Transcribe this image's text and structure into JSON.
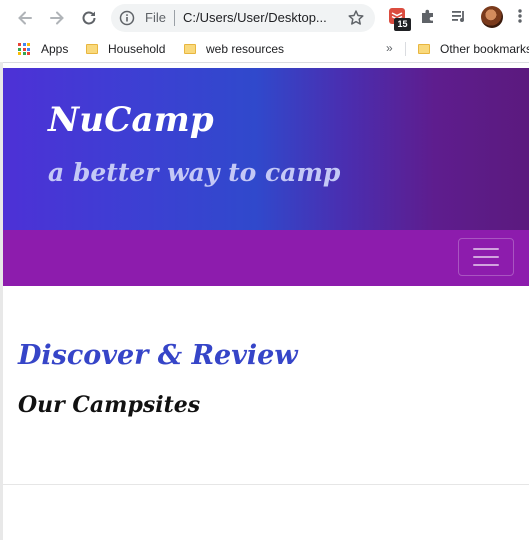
{
  "browser": {
    "address_scheme": "File",
    "address_url": "C:/Users/User/Desktop...",
    "extension_badge": "15",
    "bookmarks": [
      {
        "label": "Apps",
        "icon": "apps-grid-icon"
      },
      {
        "label": "Household",
        "icon": "folder-icon"
      },
      {
        "label": "web resources",
        "icon": "folder-icon"
      },
      {
        "label": "Other bookmarks",
        "icon": "folder-icon"
      }
    ],
    "bookmarks_overflow": "»"
  },
  "site": {
    "brand": "NuCamp",
    "tagline": "a better way to camp",
    "heading": "Discover & Review",
    "subheading": "Our Campsites"
  },
  "colors": {
    "hero_gradient_start": "#4d31d6",
    "hero_gradient_end": "#5b1a7e",
    "navbar": "#8d1cad",
    "heading": "#3645c8",
    "tagline": "#c4c8f6"
  }
}
